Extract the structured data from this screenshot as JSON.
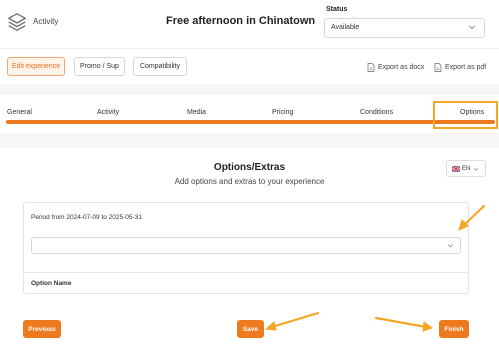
{
  "header": {
    "app_name": "Activity",
    "title": "Free afternoon in Chinatown",
    "status_label": "Status",
    "status_value": "Available"
  },
  "toolbar": {
    "buttons": [
      "Edit experience",
      "Promo / Sup",
      "Compatibility"
    ],
    "export_docx": "Export as docx",
    "export_pdf": "Export as pdf"
  },
  "tabs": [
    "General",
    "Activity",
    "Media",
    "Pricing",
    "Conditions",
    "Options"
  ],
  "main": {
    "title": "Options/Extras",
    "subtitle": "Add options and extras to your experience",
    "language": "EN",
    "period": "Period from 2024-07-09 to 2025-05-31",
    "option_name_label": "Option Name"
  },
  "actions": {
    "previous": "Previous",
    "save": "Save",
    "finish": "Finish"
  },
  "colors": {
    "accent": "#ee7a1f",
    "highlight": "#f5a623"
  }
}
